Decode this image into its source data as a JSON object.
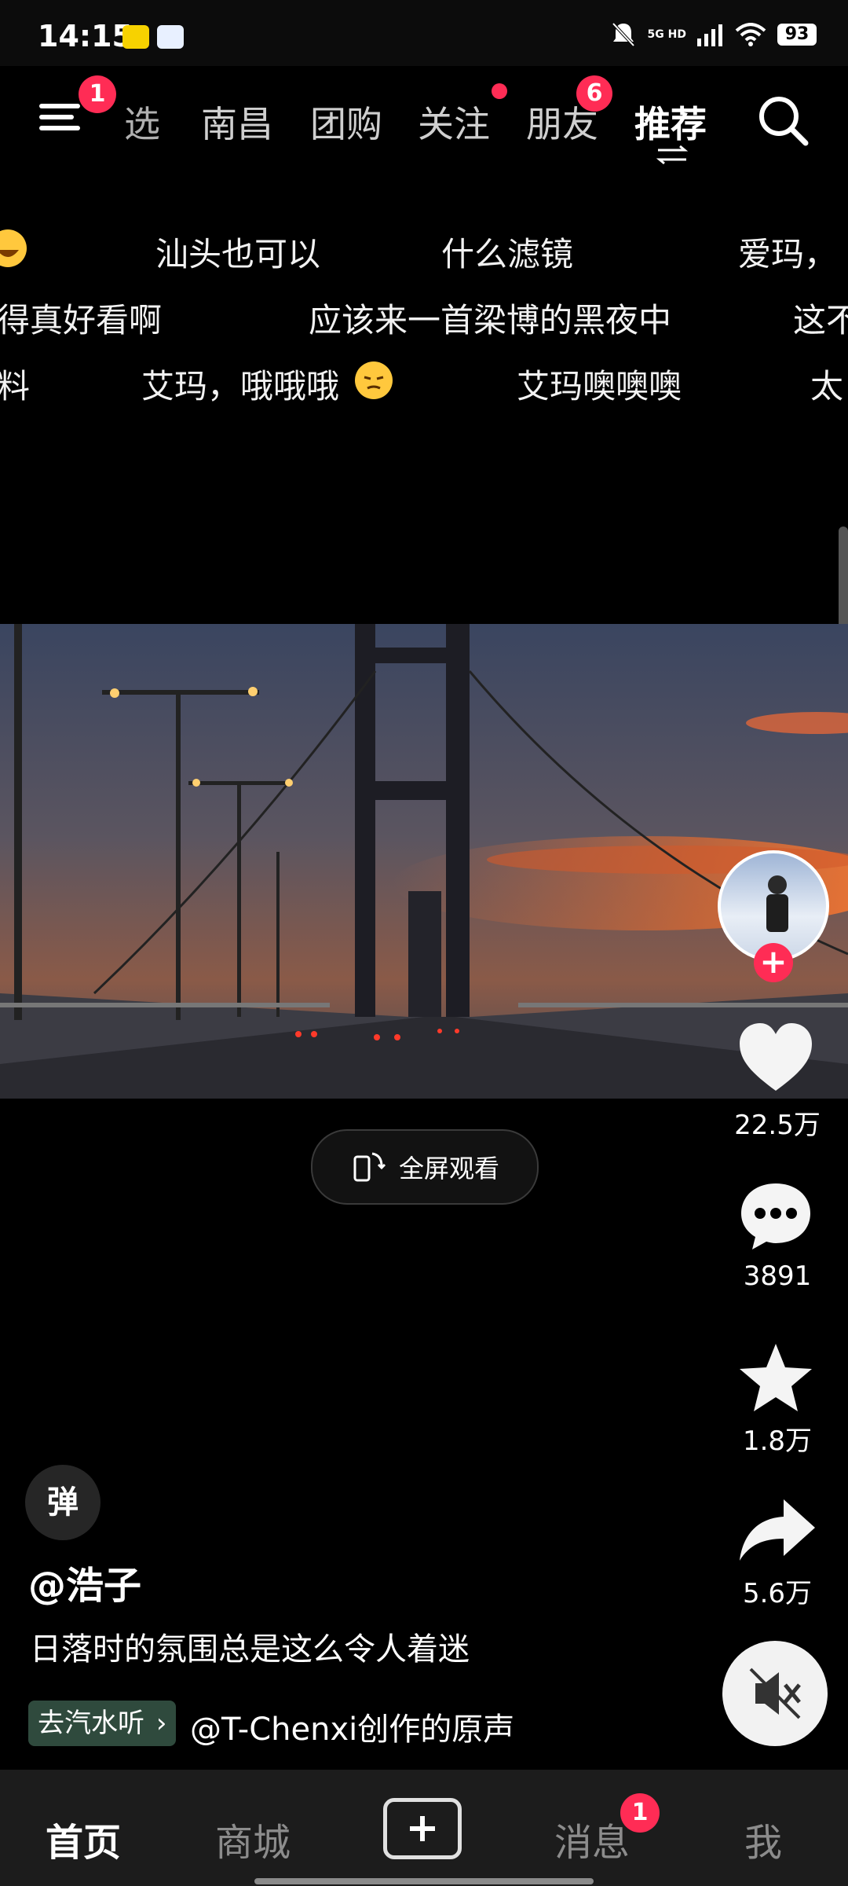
{
  "status_bar": {
    "time": "14:15",
    "network": "5G HD",
    "battery": "93"
  },
  "top_nav": {
    "menu_badge": "1",
    "tabs": [
      {
        "label": "精选",
        "shown": "选"
      },
      {
        "label": "南昌"
      },
      {
        "label": "团购"
      },
      {
        "label": "关注"
      },
      {
        "label": "朋友",
        "badge": "6"
      },
      {
        "label": "推荐",
        "active": true
      }
    ]
  },
  "danmaku": {
    "row1": [
      "汕头也可以",
      "什么滤镜",
      "爱玛，"
    ],
    "row2": [
      "得真好看啊",
      "应该来一首梁博的黑夜中",
      "这不"
    ],
    "row3": [
      "料",
      "艾玛，哦哦哦",
      "艾玛噢噢噢",
      "太"
    ]
  },
  "video": {
    "fullscreen_label": "全屏观看"
  },
  "right_rail": {
    "likes": "22.5万",
    "comments": "3891",
    "favorites": "1.8万",
    "shares": "5.6万"
  },
  "info": {
    "danmaku_toggle": "弹",
    "author": "@浩子",
    "caption": "日落时的氛围总是这么令人着迷",
    "music_tag": "去汽水听",
    "music": "@T-Chenxi创作的原声"
  },
  "bottom_nav": {
    "home": "首页",
    "mall": "商城",
    "messages": "消息",
    "messages_badge": "1",
    "me": "我"
  },
  "colors": {
    "accent": "#ff2c55",
    "background": "#000000",
    "nav_bg": "#1c1c1c"
  }
}
